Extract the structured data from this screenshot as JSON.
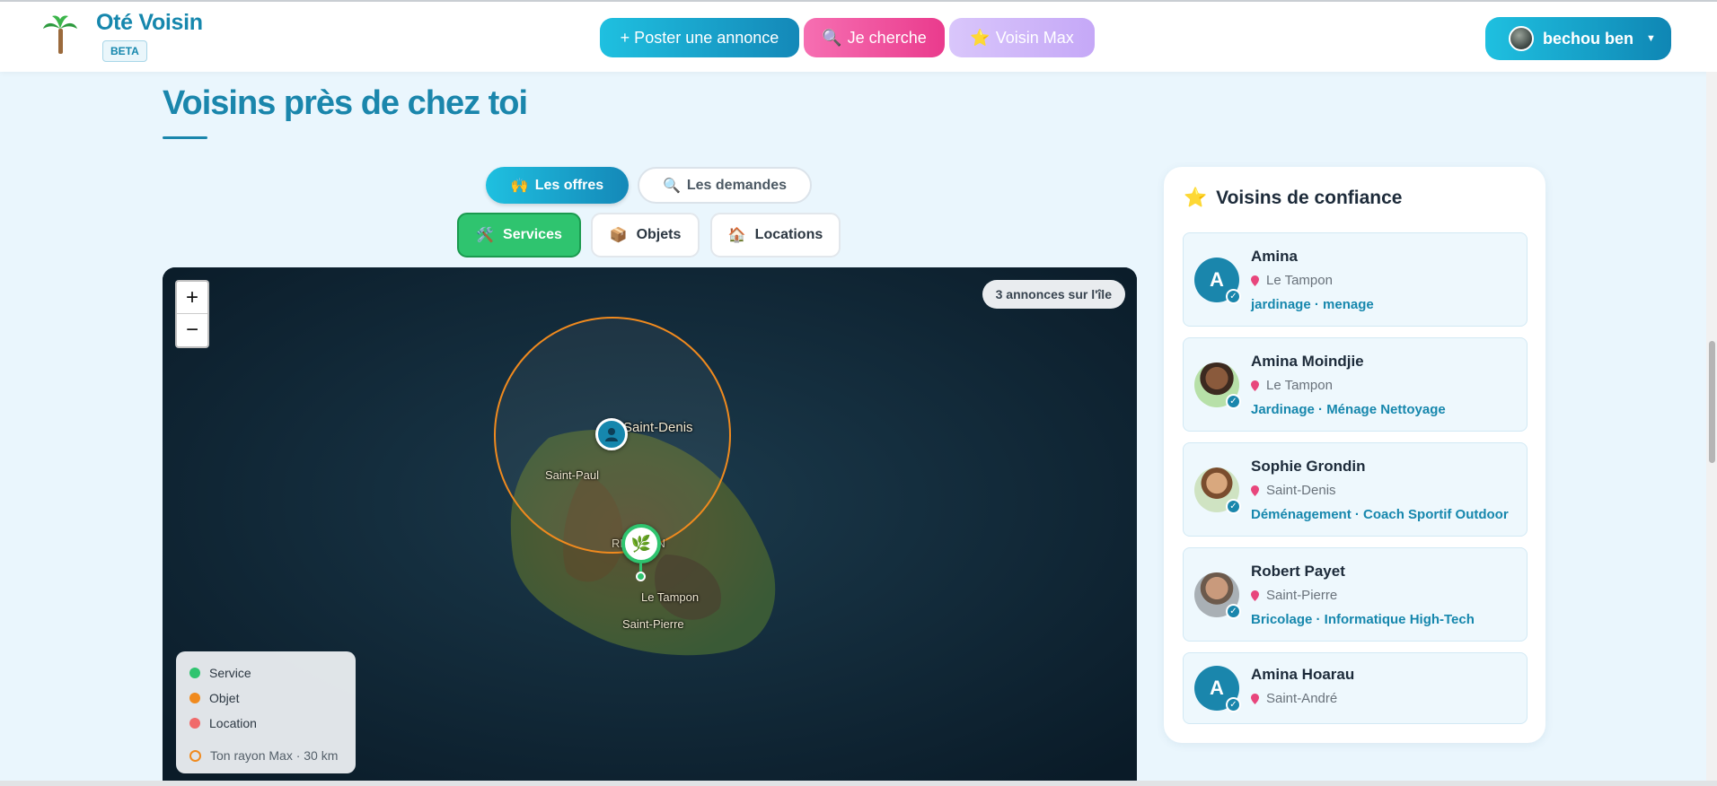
{
  "header": {
    "brand": "Oté Voisin",
    "badge": "BETA",
    "post_button": "+ Poster une annonce",
    "search_button": "Je cherche",
    "max_button": "Voisin Max",
    "user_name": "bechou ben"
  },
  "main": {
    "title": "Voisins près de chez toi",
    "tabs": {
      "offers": "Les offres",
      "requests": "Les demandes"
    },
    "categories": {
      "services": "Services",
      "objets": "Objets",
      "locations": "Locations"
    }
  },
  "map": {
    "zoom_in": "+",
    "zoom_out": "−",
    "count": "3 annonces sur l'île",
    "places": {
      "saint_denis": "Saint-Denis",
      "saint_paul": "Saint-Paul",
      "reunion": "RÉUNION",
      "le_tampon": "Le Tampon",
      "saint_pierre": "Saint-Pierre"
    },
    "legend": {
      "service": "Service",
      "objet": "Objet",
      "location": "Location",
      "radius": "Ton rayon Max · 30 km"
    },
    "colors": {
      "service": "#2fc46f",
      "objet": "#f08a1e",
      "location": "#f06a6a",
      "radius": "#f08a1e"
    }
  },
  "sidebar": {
    "title": "Voisins de confiance",
    "neighbors": [
      {
        "initial": "A",
        "name": "Amina",
        "city": "Le Tampon",
        "tags": "jardinage · menage"
      },
      {
        "initial": "",
        "name": "Amina Moindjie",
        "city": "Le Tampon",
        "tags": "Jardinage · Ménage Nettoyage"
      },
      {
        "initial": "",
        "name": "Sophie Grondin",
        "city": "Saint-Denis",
        "tags": "Déménagement · Coach Sportif Outdoor"
      },
      {
        "initial": "",
        "name": "Robert Payet",
        "city": "Saint-Pierre",
        "tags": "Bricolage · Informatique High-Tech"
      },
      {
        "initial": "A",
        "name": "Amina Hoarau",
        "city": "Saint-André",
        "tags": ""
      }
    ]
  }
}
